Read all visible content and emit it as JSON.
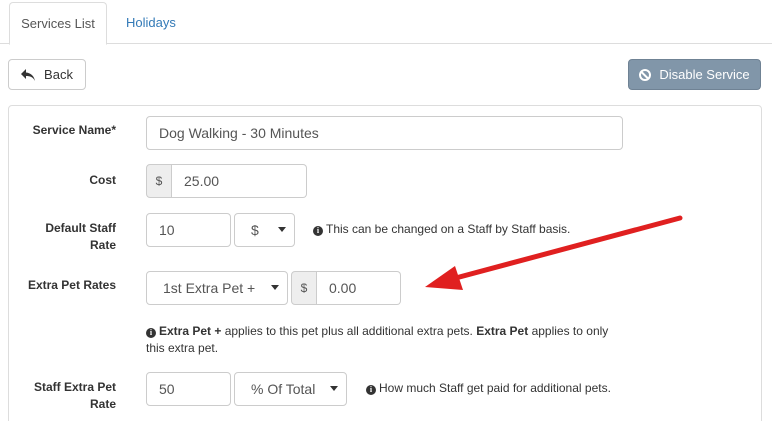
{
  "tabs": [
    {
      "label": "Services List",
      "active": true
    },
    {
      "label": "Holidays",
      "active": false
    }
  ],
  "toolbar": {
    "back_label": "Back",
    "back_icon": "reply-icon",
    "disable_label": "Disable Service",
    "disable_icon": "ban-icon",
    "disable_color": "#8196a9"
  },
  "form": {
    "service_name": {
      "label": "Service Name*",
      "value": "Dog Walking - 30 Minutes"
    },
    "cost": {
      "label": "Cost",
      "currency": "$",
      "value": "25.00"
    },
    "default_staff_rate": {
      "label_line1": "Default Staff",
      "label_line2": "Rate",
      "value": "10",
      "unit_selected": "$",
      "hint": "This can be changed on a Staff by Staff basis."
    },
    "extra_pet_rates": {
      "label": "Extra Pet Rates",
      "type_selected": "1st Extra Pet +",
      "currency": "$",
      "value": "0.00",
      "hint": {
        "bold1": "Extra Pet +",
        "text1": " applies to this pet plus all additional extra pets. ",
        "bold2": "Extra Pet",
        "text2": " applies to only",
        "line2": "this extra pet."
      }
    },
    "staff_extra_pet_rate": {
      "label_line1": "Staff Extra Pet",
      "label_line2": "Rate",
      "value": "50",
      "unit_selected": "% Of Total",
      "hint": "How much Staff get paid for additional pets."
    }
  },
  "annotation": {
    "arrow_color": "#e02020"
  }
}
